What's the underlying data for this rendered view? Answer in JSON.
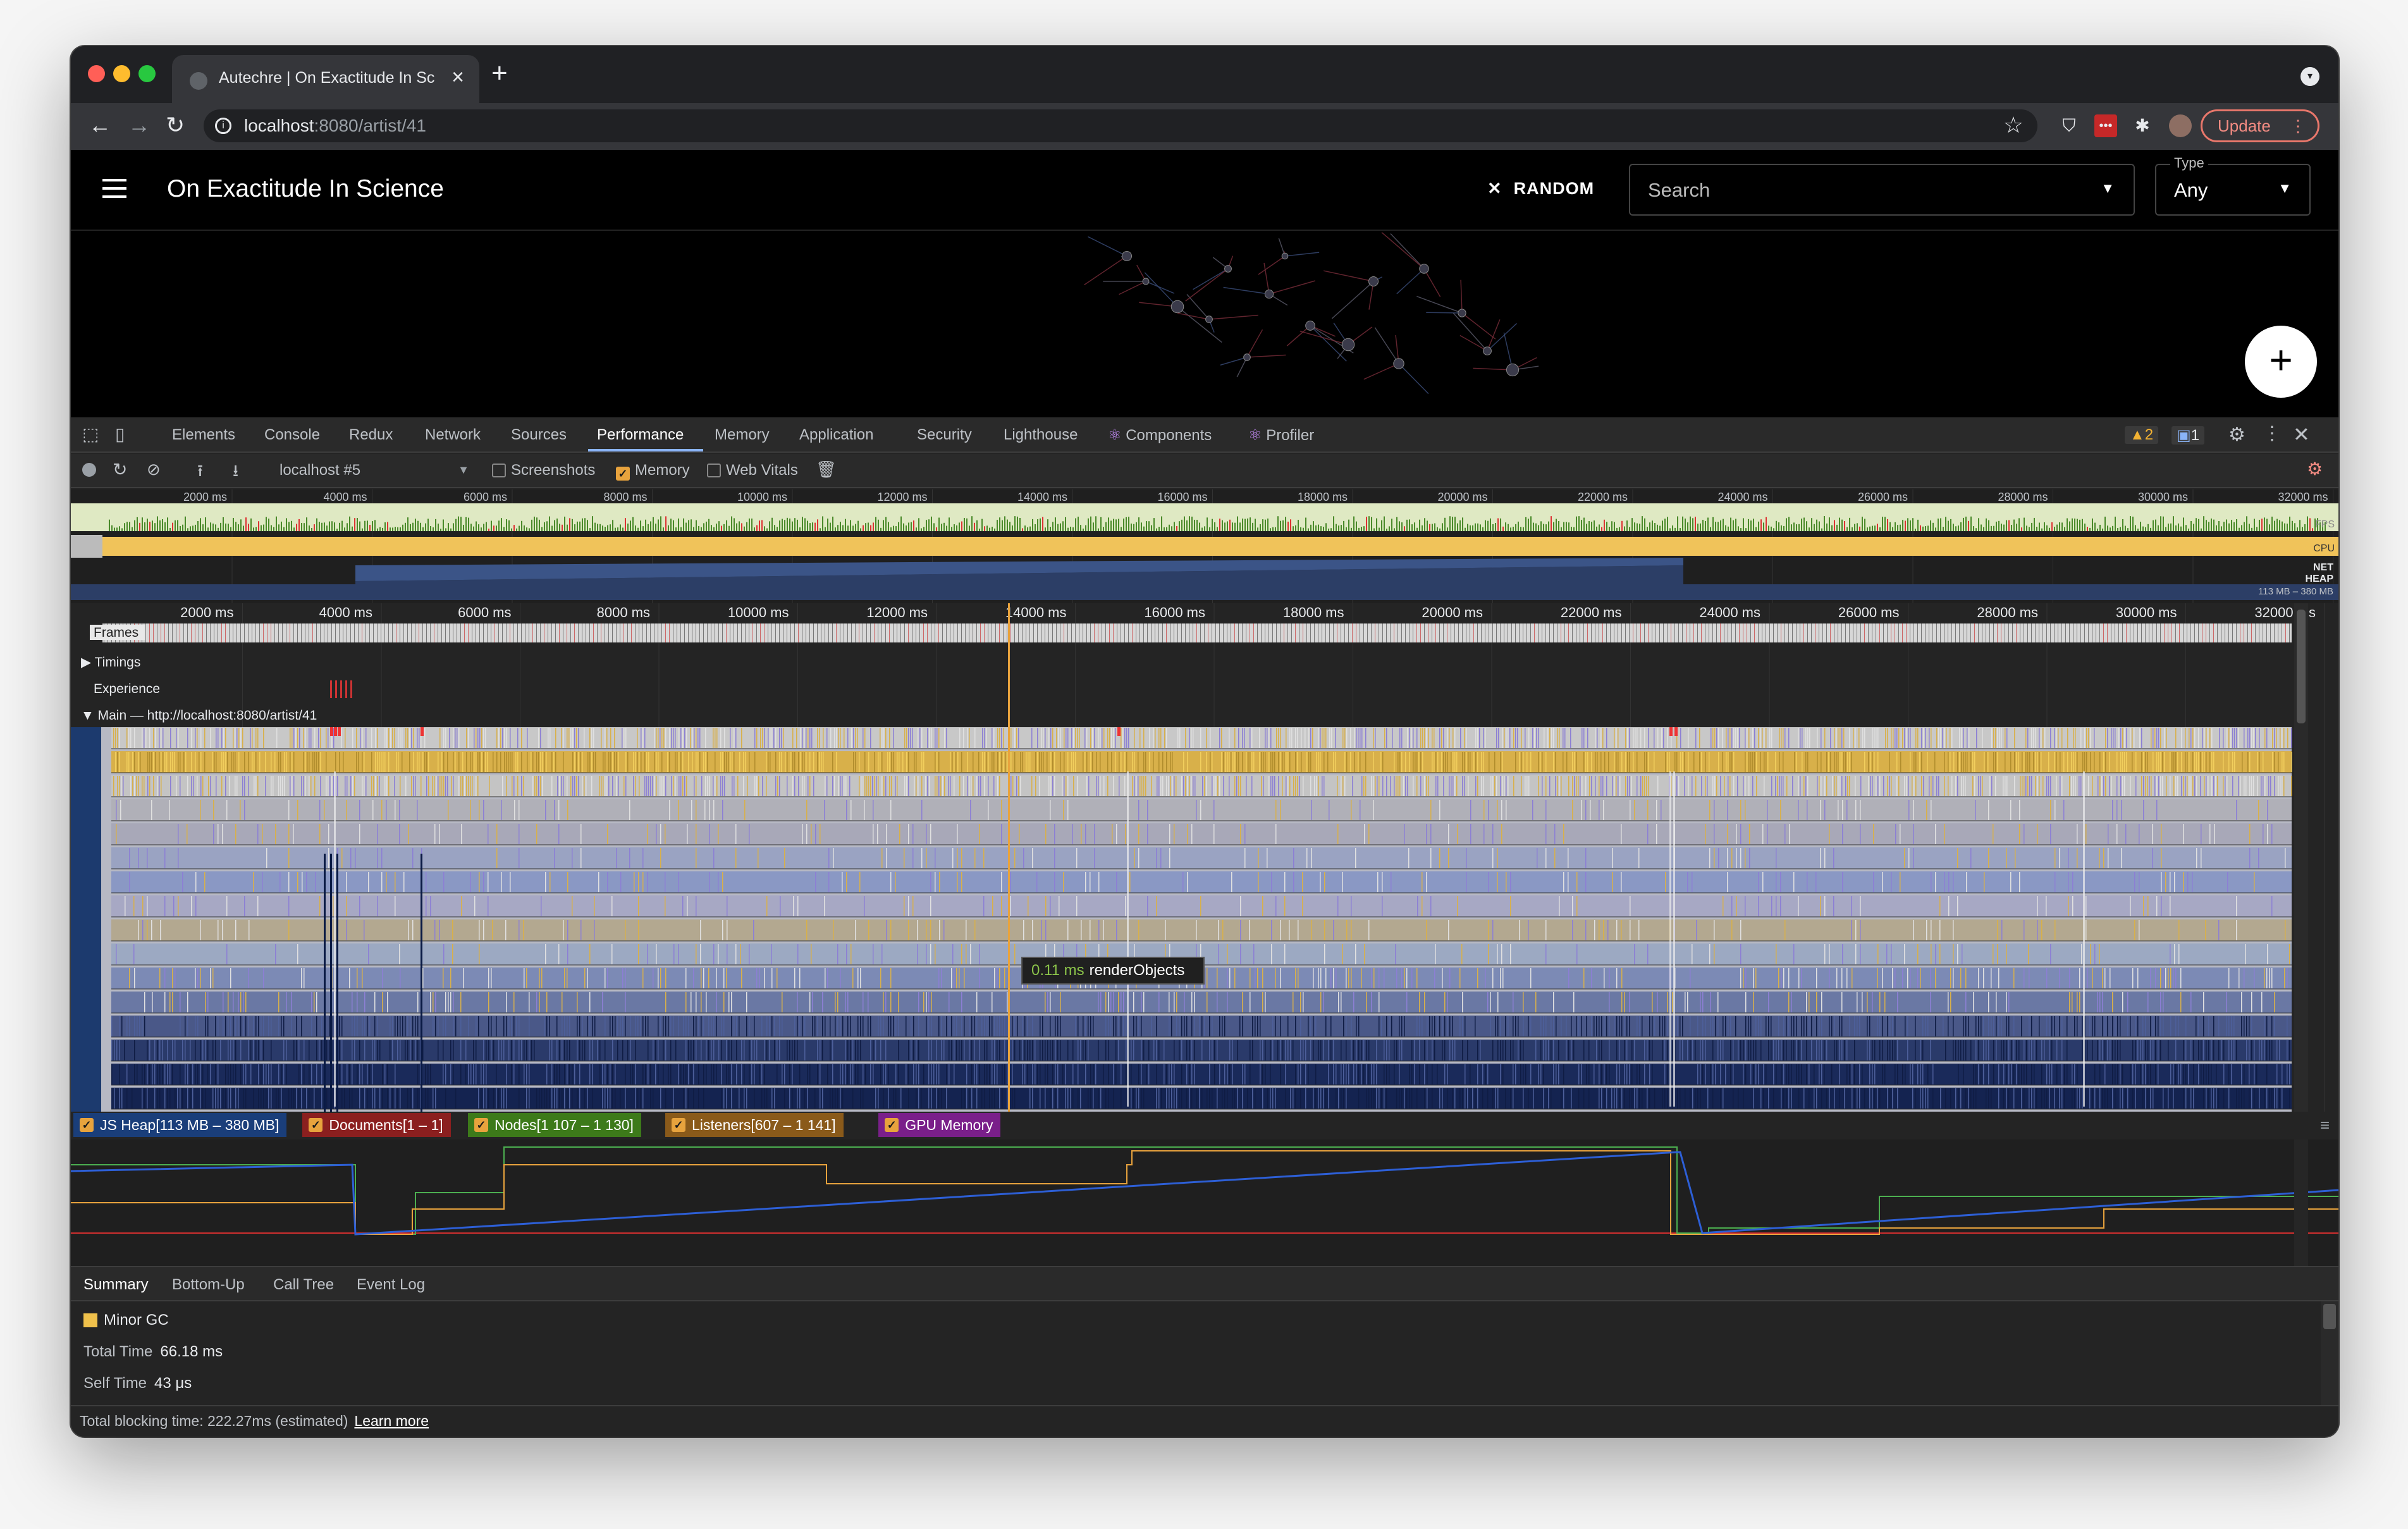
{
  "browser": {
    "tab_title": "Autechre | On Exactitude In Sc",
    "url_host": "localhost",
    "url_path": ":8080/artist/41",
    "update_label": "Update"
  },
  "app": {
    "title": "On Exactitude In Science",
    "random_label": "RANDOM",
    "search_placeholder": "Search",
    "type_label": "Type",
    "type_value": "Any",
    "fab_label": "+"
  },
  "devtools": {
    "tabs": [
      "Elements",
      "Console",
      "Redux",
      "Network",
      "Sources",
      "Performance",
      "Memory",
      "Application",
      "Security",
      "Lighthouse",
      "Components",
      "Profiler"
    ],
    "active_tab": "Performance",
    "warnings_count": "2",
    "messages_count": "1",
    "profile_select": "localhost #5",
    "screenshots_label": "Screenshots",
    "memory_label": "Memory",
    "webvitals_label": "Web Vitals",
    "overview_ticks": [
      "2000 ms",
      "4000 ms",
      "6000 ms",
      "8000 ms",
      "10000 ms",
      "12000 ms",
      "14000 ms",
      "16000 ms",
      "18000 ms",
      "20000 ms",
      "22000 ms",
      "24000 ms",
      "26000 ms",
      "28000 ms",
      "30000 ms",
      "32000 ms"
    ],
    "overview_labels": {
      "fps": "FPS",
      "cpu": "CPU",
      "net": "NET",
      "heap": "HEAP",
      "heap_range": "113 MB – 380 MB"
    },
    "tracks": {
      "frames": "Frames",
      "timings": "Timings",
      "experience": "Experience",
      "main": "Main — http://localhost:8080/artist/41"
    },
    "tooltip": {
      "duration": "0.11 ms",
      "name": "renderObjects"
    },
    "legend": [
      {
        "label": "JS Heap[113 MB – 380 MB]",
        "color": "#1a3e7a"
      },
      {
        "label": "Documents[1 – 1]",
        "color": "#8b1f1f"
      },
      {
        "label": "Nodes[1 107 – 1 130]",
        "color": "#3d7a1a"
      },
      {
        "label": "Listeners[607 – 1 141]",
        "color": "#8a5a1a"
      },
      {
        "label": "GPU Memory",
        "color": "#7a1f8a"
      }
    ],
    "bottom_tabs": [
      "Summary",
      "Bottom-Up",
      "Call Tree",
      "Event Log"
    ],
    "summary": {
      "event": "Minor GC",
      "total_time_label": "Total Time",
      "total_time": "66.18 ms",
      "self_time_label": "Self Time",
      "self_time": "43 μs"
    },
    "status_text": "Total blocking time: 222.27ms (estimated)",
    "learn_more": "Learn more"
  },
  "colors": {
    "scripting": "#d8b04a",
    "rendering": "#8c7fd4",
    "timeline_cursor": "#e8a33d",
    "js_heap_line": "#2d5fd6",
    "nodes_line": "#4caf50",
    "listeners_line": "#e8a33d",
    "documents_line": "#d32f2f"
  },
  "icons": [
    "inspect-icon",
    "device-icon",
    "record-icon",
    "reload-icon",
    "clear-icon",
    "upload-icon",
    "download-icon",
    "trash-icon",
    "gear-icon",
    "more-icon",
    "close-icon",
    "hamburger-icon",
    "shuffle-icon",
    "chevron-down-icon",
    "star-icon",
    "extension-icon"
  ]
}
